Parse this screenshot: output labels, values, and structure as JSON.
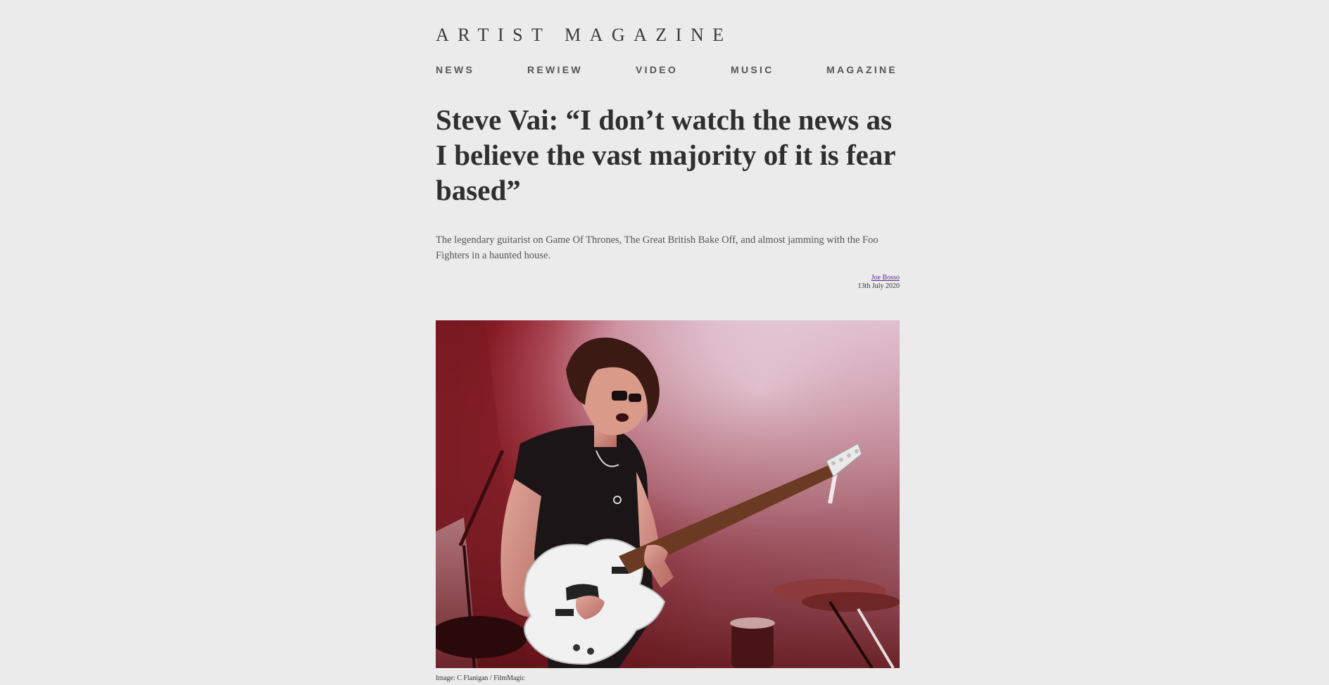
{
  "site": {
    "title": "ARTIST MAGAZINE"
  },
  "nav": {
    "items": [
      {
        "label": "NEWS"
      },
      {
        "label": "REWIEW"
      },
      {
        "label": "VIDEO"
      },
      {
        "label": "MUSIC"
      },
      {
        "label": "MAGAZINE"
      }
    ]
  },
  "article": {
    "headline": "Steve Vai: “I don’t watch the news as I believe the vast majority of it is fear based”",
    "standfirst": "The legendary guitarist on Game Of Thrones, The Great British Bake Off, and almost jamming with the Foo Fighters in a haunted house.",
    "author": "Joe Bosso",
    "date": "13th July 2020",
    "image_caption": "Image: C Flanigan / FilmMagic"
  },
  "colors": {
    "background": "#ebebeb",
    "text": "#333333",
    "link_visited": "#5a2a8a",
    "photo_red": "#8a1c24",
    "photo_haze": "#e9d6e4"
  },
  "icons": {
    "hero_image": "guitarist-on-stage-photo"
  }
}
